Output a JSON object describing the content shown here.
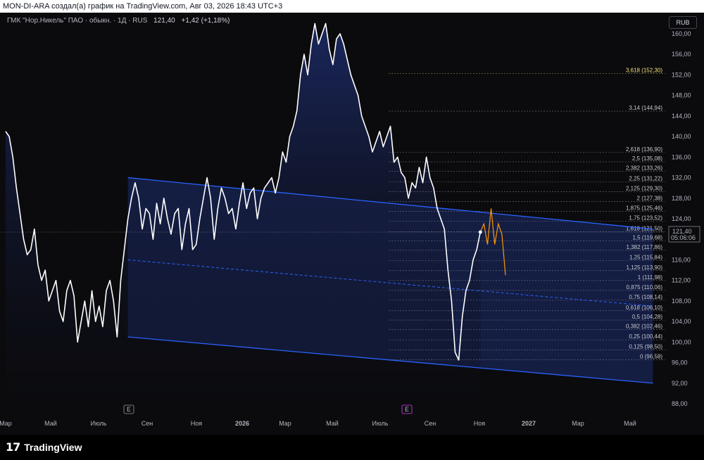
{
  "header": {
    "text": "MON-DI-ARA создал(а) график на TradingView.com, Авг 03, 2026 18:43 UTC+3"
  },
  "symbol": {
    "name": "ГМК \"Нор.Никель\" ПАО · обыкн. · 1Д · RUS",
    "price": "121,40",
    "change": "+1,42 (+1,18%)"
  },
  "currency": "RUB",
  "logo": {
    "mark": "17",
    "text": "TradingView"
  },
  "last_price_label": {
    "price": "121,40",
    "timer": "05:06:06"
  },
  "event_markers": [
    "E",
    "E"
  ],
  "colors": {
    "price_line": "#ffffff",
    "channel": "#2962ff",
    "channel_fill": "#1e2e6e",
    "projection": "#ff9800",
    "fib_highlight": "#f5e37a"
  },
  "chart_data": {
    "type": "line",
    "y_axis": {
      "range": [
        87,
        163
      ],
      "ticks": [
        "160,00",
        "156,00",
        "152,00",
        "148,00",
        "144,00",
        "140,00",
        "136,00",
        "132,00",
        "128,00",
        "124,00",
        "120,00",
        "116,00",
        "112,00",
        "108,00",
        "104,00",
        "100,00",
        "96,00",
        "92,00",
        "88,00"
      ]
    },
    "x_axis": {
      "ticks": [
        "Мар",
        "Май",
        "Июль",
        "Сен",
        "Ноя",
        "2026",
        "Мар",
        "Май",
        "Июль",
        "Сен",
        "Ноя",
        "2027",
        "Мар",
        "Май"
      ]
    },
    "series": [
      {
        "values": [
          [
            0,
            141
          ],
          [
            1,
            140
          ],
          [
            2,
            136
          ],
          [
            3,
            130
          ],
          [
            4,
            125
          ],
          [
            5,
            120
          ],
          [
            6,
            117
          ],
          [
            7,
            118
          ],
          [
            8,
            122
          ],
          [
            9,
            115
          ],
          [
            10,
            112
          ],
          [
            11,
            114
          ],
          [
            12,
            108
          ],
          [
            13,
            110
          ],
          [
            14,
            112
          ],
          [
            15,
            106
          ],
          [
            16,
            104
          ],
          [
            17,
            110
          ],
          [
            18,
            112
          ],
          [
            19,
            109
          ],
          [
            20,
            100
          ],
          [
            21,
            104
          ],
          [
            22,
            108
          ],
          [
            23,
            103
          ],
          [
            24,
            110
          ],
          [
            25,
            104
          ],
          [
            26,
            107
          ],
          [
            27,
            103
          ],
          [
            28,
            110
          ],
          [
            29,
            112
          ],
          [
            30,
            108
          ],
          [
            31,
            101
          ],
          [
            32,
            112
          ],
          [
            33,
            118
          ],
          [
            34,
            124
          ],
          [
            35,
            128
          ],
          [
            36,
            131
          ],
          [
            37,
            128
          ],
          [
            38,
            122
          ],
          [
            39,
            126
          ],
          [
            40,
            125
          ],
          [
            41,
            120
          ],
          [
            42,
            127
          ],
          [
            43,
            123
          ],
          [
            44,
            128
          ],
          [
            45,
            124
          ],
          [
            46,
            121
          ],
          [
            47,
            125
          ],
          [
            48,
            126
          ],
          [
            49,
            118
          ],
          [
            50,
            123
          ],
          [
            51,
            126
          ],
          [
            52,
            118
          ],
          [
            53,
            119
          ],
          [
            54,
            124
          ],
          [
            55,
            128
          ],
          [
            56,
            132
          ],
          [
            57,
            128
          ],
          [
            58,
            120
          ],
          [
            59,
            126
          ],
          [
            60,
            130
          ],
          [
            61,
            128
          ],
          [
            62,
            125
          ],
          [
            63,
            126
          ],
          [
            64,
            122
          ],
          [
            65,
            127
          ],
          [
            66,
            131
          ],
          [
            67,
            126
          ],
          [
            68,
            129
          ],
          [
            69,
            130
          ],
          [
            70,
            124
          ],
          [
            71,
            128
          ],
          [
            72,
            130
          ],
          [
            73,
            131
          ],
          [
            74,
            132
          ],
          [
            75,
            129
          ],
          [
            76,
            132
          ],
          [
            77,
            137
          ],
          [
            78,
            135
          ],
          [
            79,
            140
          ],
          [
            80,
            142
          ],
          [
            81,
            145
          ],
          [
            82,
            152
          ],
          [
            83,
            156
          ],
          [
            84,
            152
          ],
          [
            85,
            158
          ],
          [
            86,
            162
          ],
          [
            87,
            158
          ],
          [
            88,
            160
          ],
          [
            89,
            162
          ],
          [
            90,
            157
          ],
          [
            91,
            154
          ],
          [
            92,
            159
          ],
          [
            93,
            160
          ],
          [
            94,
            158
          ],
          [
            95,
            155
          ],
          [
            96,
            152
          ],
          [
            97,
            150
          ],
          [
            98,
            148
          ],
          [
            99,
            144
          ],
          [
            100,
            142
          ],
          [
            101,
            140
          ],
          [
            102,
            137
          ],
          [
            103,
            139
          ],
          [
            104,
            141
          ],
          [
            105,
            138
          ],
          [
            106,
            140
          ],
          [
            107,
            142
          ],
          [
            108,
            135
          ],
          [
            109,
            136
          ],
          [
            110,
            133
          ],
          [
            111,
            132
          ],
          [
            112,
            128
          ],
          [
            113,
            131
          ],
          [
            114,
            130
          ],
          [
            115,
            134
          ],
          [
            116,
            131
          ],
          [
            117,
            136
          ],
          [
            118,
            132
          ],
          [
            119,
            130
          ],
          [
            120,
            126
          ],
          [
            121,
            124
          ],
          [
            122,
            122
          ],
          [
            123,
            114
          ],
          [
            124,
            108
          ],
          [
            125,
            98
          ],
          [
            126,
            96.5
          ],
          [
            127,
            105
          ],
          [
            128,
            110
          ],
          [
            129,
            112
          ],
          [
            130,
            116
          ],
          [
            131,
            118
          ],
          [
            132,
            121.4
          ]
        ]
      }
    ],
    "projection": [
      [
        132,
        121.4
      ],
      [
        133,
        123
      ],
      [
        134,
        119
      ],
      [
        135,
        126
      ],
      [
        136,
        119
      ],
      [
        137,
        123
      ],
      [
        138,
        121
      ],
      [
        139,
        113
      ]
    ],
    "regression_channel": {
      "upper": [
        [
          34,
          132
        ],
        [
          180,
          122
        ]
      ],
      "mid": [
        [
          34,
          116
        ],
        [
          180,
          107
        ]
      ],
      "lower": [
        [
          34,
          101
        ],
        [
          180,
          92
        ]
      ]
    },
    "fib_levels": [
      {
        "label": "0 (96,58)",
        "value": 96.58
      },
      {
        "label": "0,125 (98,50)",
        "value": 98.5
      },
      {
        "label": "0,25 (100,44)",
        "value": 100.44
      },
      {
        "label": "0,382 (102,46)",
        "value": 102.46
      },
      {
        "label": "0,5 (104,28)",
        "value": 104.28
      },
      {
        "label": "0,618 (106,10)",
        "value": 106.1
      },
      {
        "label": "0,75 (108,14)",
        "value": 108.14
      },
      {
        "label": "0,875 (110,06)",
        "value": 110.06
      },
      {
        "label": "1 (111,98)",
        "value": 111.98
      },
      {
        "label": "1,125 (113,90)",
        "value": 113.9
      },
      {
        "label": "1,25 (115,84)",
        "value": 115.84
      },
      {
        "label": "1,382 (117,86)",
        "value": 117.86
      },
      {
        "label": "1,5 (119,68)",
        "value": 119.68
      },
      {
        "label": "1,618 (121,50)",
        "value": 121.5
      },
      {
        "label": "1,75 (123,52)",
        "value": 123.52
      },
      {
        "label": "1,875 (125,46)",
        "value": 125.46
      },
      {
        "label": "2 (127,38)",
        "value": 127.38
      },
      {
        "label": "2,125 (129,30)",
        "value": 129.3
      },
      {
        "label": "2,25 (131,22)",
        "value": 131.22
      },
      {
        "label": "2,382 (133,26)",
        "value": 133.26
      },
      {
        "label": "2,5 (135,08)",
        "value": 135.08
      },
      {
        "label": "2,618 (136,90)",
        "value": 136.9
      },
      {
        "label": "3,14 (144,94)",
        "value": 144.94
      },
      {
        "label": "3,618 (152,30)",
        "value": 152.3
      }
    ]
  }
}
